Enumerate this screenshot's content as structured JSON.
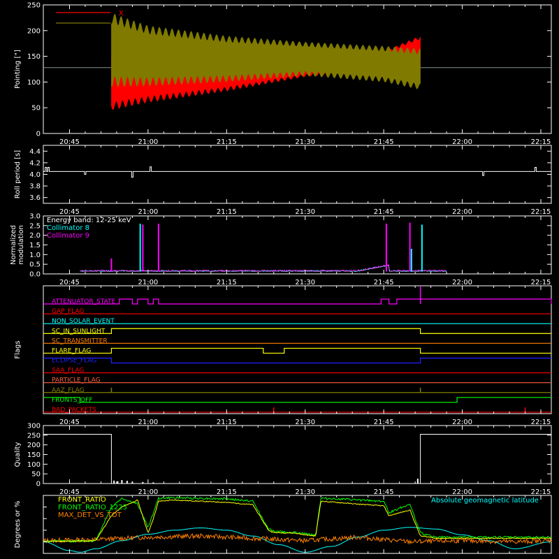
{
  "time_axis": {
    "ticks": [
      "20:45",
      "21:00",
      "21:15",
      "21:30",
      "21:45",
      "22:00",
      "22:15"
    ]
  },
  "colors": {
    "background": "#000000",
    "axes": "#ffffff",
    "x": "#ff0000",
    "y": "#807a00",
    "cyan": "#00ffff",
    "magenta": "#ff00ff",
    "yellow": "#ffff00",
    "green": "#00ff00",
    "orange": "#ff8000",
    "blue": "#2020ff",
    "lightred": "#ff6040",
    "olive": "#808000"
  },
  "chart_data": [
    {
      "id": "pointing",
      "type": "line",
      "ylabel": "Pointing [\"]",
      "ylim": [
        0,
        250
      ],
      "yticks": [
        0,
        50,
        100,
        150,
        200,
        250
      ],
      "legend": [
        {
          "name": "X",
          "color": "#ff0000"
        },
        {
          "name": "Y",
          "color": "#807a00"
        }
      ],
      "baseline": 128,
      "active_range": [
        "20:53",
        "21:52"
      ],
      "series": [
        {
          "name": "X",
          "envelope": {
            "x": [
              "20:53",
              "21:00",
              "21:15",
              "21:30",
              "21:45",
              "21:52"
            ],
            "low": [
              45,
              60,
              82,
              110,
              125,
              140
            ],
            "high": [
              160,
              150,
              145,
              150,
              160,
              190
            ]
          }
        },
        {
          "name": "Y",
          "envelope": {
            "x": [
              "20:53",
              "21:00",
              "21:15",
              "21:30",
              "21:45",
              "21:52"
            ],
            "low": [
              90,
              92,
              100,
              112,
              100,
              85
            ],
            "high": [
              235,
              210,
              190,
              178,
              170,
              165
            ]
          }
        }
      ]
    },
    {
      "id": "roll",
      "type": "line",
      "ylabel": "Roll period [s]",
      "ylim": [
        3.5,
        4.5
      ],
      "yticks": [
        3.6,
        3.8,
        4.0,
        4.2,
        4.4
      ],
      "baseline": 4.05,
      "spikes": [
        {
          "t": "20:40.5",
          "v": 4.12
        },
        {
          "t": "20:41",
          "v": 4.12
        },
        {
          "t": "20:48",
          "v": 4.0
        },
        {
          "t": "20:57",
          "v": 3.95
        },
        {
          "t": "21:00.5",
          "v": 4.13
        },
        {
          "t": "22:04",
          "v": 3.98
        },
        {
          "t": "22:14",
          "v": 4.12
        }
      ]
    },
    {
      "id": "modulation",
      "type": "line",
      "ylabel": [
        "Normalized",
        "modulation"
      ],
      "ylim": [
        0,
        3.0
      ],
      "yticks": [
        0.0,
        0.5,
        1.0,
        1.5,
        2.0,
        2.5,
        3.0
      ],
      "legend": [
        {
          "name": "Energy band: 12-25 keV",
          "color": "#ffffff"
        },
        {
          "name": "Collimator 8",
          "color": "#00ffff"
        },
        {
          "name": "Collimator 9",
          "color": "#ff00ff"
        }
      ],
      "range": [
        "20:47",
        "21:57"
      ],
      "base": 0.12,
      "spikes": [
        {
          "t": "20:53",
          "v": 0.8,
          "c": "#ff00ff"
        },
        {
          "t": "20:58.5",
          "v": 2.6,
          "c": "#00ffff"
        },
        {
          "t": "20:59",
          "v": 2.55,
          "c": "#ff00ff"
        },
        {
          "t": "21:02",
          "v": 2.6,
          "c": "#ff00ff"
        },
        {
          "t": "21:45.5",
          "v": 2.6,
          "c": "#ff00ff"
        },
        {
          "t": "21:50",
          "v": 2.65,
          "c": "#ff00ff"
        },
        {
          "t": "21:50.3",
          "v": 1.3,
          "c": "#00ffff"
        },
        {
          "t": "21:52.3",
          "v": 2.55,
          "c": "#00ffff"
        }
      ]
    },
    {
      "id": "flags",
      "type": "line",
      "ylabel": "Flags",
      "rows": [
        {
          "name": "ATTENUATOR_STATE",
          "color": "#ff00ff",
          "steps": [
            [
              "20:54.5",
              "20:57"
            ],
            [
              "20:58",
              "21:00"
            ],
            [
              "21:01",
              "21:02"
            ],
            [
              "21:44.5",
              "21:46"
            ],
            [
              "21:47.5",
              "21:52"
            ],
            [
              "21:52",
              "22:17"
            ]
          ],
          "tall_at": "21:52"
        },
        {
          "name": "GAP_FLAG",
          "color": "#ff0000",
          "steps": []
        },
        {
          "name": "NON_SOLAR_EVENT",
          "color": "#00ffff",
          "steps": []
        },
        {
          "name": "SC_IN_SUNLIGHT",
          "color": "#ffff00",
          "steps": [
            [
              "20:53",
              "21:52"
            ]
          ]
        },
        {
          "name": "SC_TRANSMITTER",
          "color": "#ff8000",
          "steps": []
        },
        {
          "name": "FLARE_FLAG",
          "color": "#ffff00",
          "steps": [
            [
              "20:53",
              "21:22"
            ],
            [
              "21:26",
              "21:52"
            ]
          ]
        },
        {
          "name": "ECLIPSE_FLAG",
          "color": "#2020ff",
          "steps": [
            [
              "20:53",
              "21:52"
            ]
          ],
          "inverted": true
        },
        {
          "name": "SAA_FLAG",
          "color": "#ff0000",
          "steps": []
        },
        {
          "name": "PARTICLE_FLAG",
          "color": "#ff6040",
          "steps": []
        },
        {
          "name": "AAZ_FLAG",
          "color": "#808000",
          "steps": [],
          "pulses": [
            "20:53",
            "21:52"
          ]
        },
        {
          "name": "FRONTS_OFF",
          "color": "#00ff00",
          "steps": [
            [
              "20:47",
              "21:59"
            ]
          ],
          "inverted": true
        },
        {
          "name": "BAD_PACKETS",
          "color": "#ff0000",
          "steps": [],
          "pulses": [
            "21:24",
            "22:12"
          ]
        }
      ]
    },
    {
      "id": "quality",
      "type": "line",
      "ylabel": "Quality",
      "ylim": [
        0,
        300
      ],
      "yticks": [
        0,
        50,
        100,
        150,
        200,
        250,
        300
      ],
      "segments": [
        {
          "from": "20:40",
          "to": "20:53",
          "v": 255
        },
        {
          "from": "20:53",
          "to": "21:52",
          "v": 0
        },
        {
          "from": "21:52",
          "to": "22:17",
          "v": 255
        }
      ],
      "spikes": [
        {
          "t": "20:53.5",
          "v": 15
        },
        {
          "t": "20:54.2",
          "v": 12
        },
        {
          "t": "20:55",
          "v": 18
        },
        {
          "t": "20:56",
          "v": 14
        },
        {
          "t": "20:57",
          "v": 10
        },
        {
          "t": "20:59",
          "v": 8
        },
        {
          "t": "21:01",
          "v": 6
        },
        {
          "t": "21:51.5",
          "v": 25
        }
      ]
    },
    {
      "id": "front",
      "type": "line",
      "ylabel": "Degrees or %",
      "ylim": [
        0,
        100
      ],
      "legend": [
        {
          "name": "FRONT_RATIO",
          "color": "#ffff00"
        },
        {
          "name": "FRONT_RATIO_1225",
          "color": "#00ff00"
        },
        {
          "name": "MAX_DET_VS_TOT",
          "color": "#ff8000"
        },
        {
          "name": "Absolute geomagnetic latitude",
          "color": "#00ffff"
        }
      ],
      "series": [
        {
          "name": "FRONT_RATIO",
          "x": [
            "20:40",
            "20:46",
            "20:50",
            "20:53",
            "20:55",
            "20:58",
            "21:00",
            "21:01",
            "21:02",
            "21:05",
            "21:15",
            "21:20",
            "21:23",
            "21:24",
            "21:28",
            "21:30",
            "21:32",
            "21:33",
            "21:36",
            "21:40",
            "21:45",
            "21:46",
            "21:48",
            "21:50",
            "21:52",
            "21:54",
            "21:55",
            "22:17"
          ],
          "y": [
            21,
            21,
            22,
            65,
            80,
            92,
            35,
            60,
            90,
            92,
            88,
            84,
            40,
            36,
            35,
            32,
            30,
            90,
            88,
            85,
            82,
            65,
            70,
            75,
            30,
            28,
            26,
            26
          ]
        },
        {
          "name": "FRONT_RATIO_1225",
          "x": [
            "20:40",
            "20:46",
            "20:50",
            "20:53",
            "20:55",
            "20:58",
            "21:00",
            "21:01",
            "21:02",
            "21:05",
            "21:15",
            "21:20",
            "21:23",
            "21:24",
            "21:28",
            "21:30",
            "21:32",
            "21:33",
            "21:36",
            "21:40",
            "21:45",
            "21:46",
            "21:48",
            "21:50",
            "21:52",
            "21:54",
            "21:55",
            "22:17"
          ],
          "y": [
            21,
            21,
            22,
            80,
            95,
            85,
            45,
            70,
            95,
            96,
            94,
            90,
            42,
            38,
            36,
            34,
            32,
            95,
            94,
            92,
            90,
            70,
            78,
            85,
            35,
            30,
            28,
            28
          ]
        },
        {
          "name": "MAX_DET_VS_TOT",
          "x": [
            "20:40",
            "20:50",
            "21:00",
            "21:10",
            "21:20",
            "21:30",
            "21:40",
            "21:50",
            "22:00",
            "22:10",
            "22:17"
          ],
          "y": [
            22,
            24,
            28,
            30,
            26,
            22,
            28,
            20,
            22,
            20,
            22
          ]
        },
        {
          "name": "Absolute geomagnetic latitude",
          "x": [
            "20:40",
            "20:45",
            "20:47",
            "20:50",
            "20:55",
            "21:00",
            "21:05",
            "21:10",
            "21:15",
            "21:20",
            "21:25",
            "21:30",
            "21:35",
            "21:40",
            "21:45",
            "21:50",
            "21:55",
            "22:00",
            "22:05",
            "22:10",
            "22:17"
          ],
          "y": [
            20,
            5,
            2,
            8,
            22,
            33,
            40,
            44,
            40,
            30,
            15,
            2,
            12,
            28,
            40,
            45,
            42,
            32,
            22,
            8,
            20
          ]
        }
      ]
    }
  ]
}
